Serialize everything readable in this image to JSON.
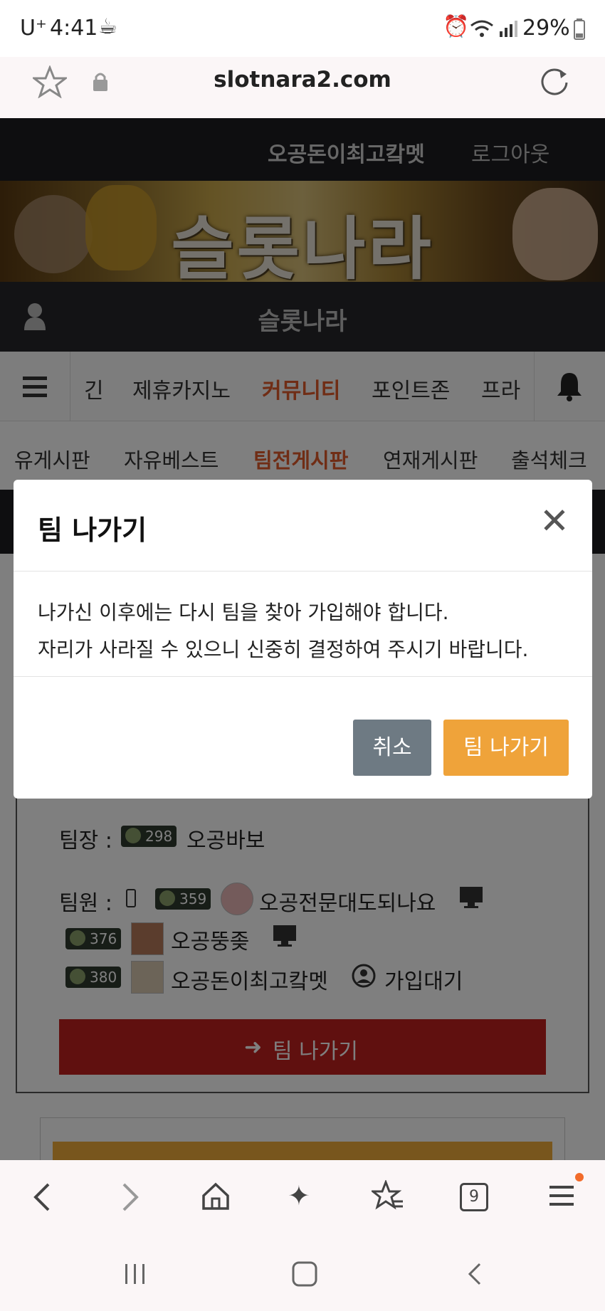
{
  "status_bar": {
    "carrier": "U⁺",
    "time": "4:41",
    "battery": "29%",
    "icons": [
      "coffee-icon",
      "alarm-icon",
      "wifi-icon",
      "signal-icon",
      "battery-icon"
    ]
  },
  "browser": {
    "url": "slotnara2.com",
    "icons": [
      "star-icon",
      "lock-icon",
      "reload-icon"
    ]
  },
  "site": {
    "username": "오공돈이최고캌멧",
    "logout": "로그아웃",
    "banner_title": "슬롯나라",
    "site_name": "슬롯나라",
    "nav_items": [
      "긴",
      "제휴카지노",
      "커뮤니티",
      "포인트존",
      "프라"
    ],
    "nav_active": "커뮤니티",
    "subnav_items": [
      "유게시판",
      "자유베스트",
      "팀전게시판",
      "연재게시판",
      "출석체크"
    ],
    "subnav_active": "팀전게시판"
  },
  "team": {
    "leader_label": "팀장 :",
    "leader": {
      "level": "298",
      "name": "오공바보"
    },
    "members_label": "팀원 :",
    "members": [
      {
        "level": "359",
        "name": "오공전문대도되나요"
      },
      {
        "level": "376",
        "name": "오공뚱좆"
      },
      {
        "level": "380",
        "name": "오공돈이최고캌멧"
      }
    ],
    "pending": "가입대기",
    "leave_button": "팀 나가기"
  },
  "modal": {
    "title": "팀 나가기",
    "line1": "나가신 이후에는 다시 팀을 찾아 가입해야 합니다.",
    "line2": "자리가 사라질 수 있으니 신중히 결정하여 주시기 바랍니다.",
    "cancel": "취소",
    "confirm": "팀 나가기"
  },
  "toolbar": {
    "tabs_count": "9",
    "icons": [
      "back-icon",
      "forward-icon",
      "home-icon",
      "sparkle-icon",
      "bookmarks-icon",
      "tabs-icon",
      "menu-icon"
    ]
  },
  "colors": {
    "accent_orange": "#efa33a",
    "active_nav": "#e05a2a",
    "leave_red": "#c0201e",
    "cancel_gray": "#6e7a83"
  }
}
